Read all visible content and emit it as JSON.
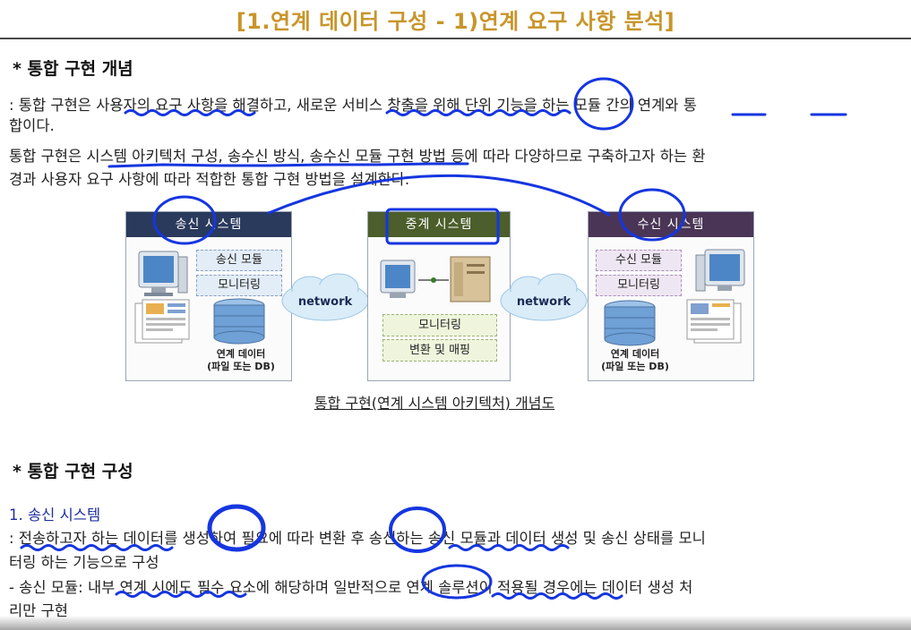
{
  "title": "[1.연계 데이터 구성 - 1)연계 요구 사항 분석]",
  "section1": {
    "heading": "* 통합 구현 개념",
    "para1_line1": ": 통합 구현은 사용자의 요구 사항을 해결하고, 새로운 서비스 창출을 위해 단위 기능을 하는 모듈 간의 연계와 통",
    "para1_line2": "합이다.",
    "para2_line1": "통합 구현은 시스템 아키텍처 구성, 송수신 방식, 송수신 모듈 구현 방법 등에 따라 다양하므로 구축하고자 하는 환",
    "para2_line2": "경과 사용자 요구 사항에 따라 적합한 통합 구현 방법을 설계한다."
  },
  "diagram": {
    "sender": {
      "header": "송신 시스템",
      "module": "송신 모듈",
      "monitor": "모니터링",
      "db_line1": "연계 데이터",
      "db_line2": "(파일 또는 DB)"
    },
    "relay": {
      "header": "중계 시스템",
      "monitor": "모니터링",
      "mapping": "변환 및 매핑"
    },
    "receiver": {
      "header": "수신 시스템",
      "module": "수신 모듈",
      "monitor": "모니터링",
      "db_line1": "연계 데이터",
      "db_line2": "(파일 또는 DB)"
    },
    "network_left": "network",
    "network_right": "network",
    "caption": "통합 구현(연계 시스템 아키텍처) 개념도"
  },
  "section2": {
    "heading": "* 통합 구현 구성",
    "subheading": "1. 송신 시스템",
    "line1": ": 전송하고자 하는 데이터를 생성하여 필요에 따라 변환 후 송신하는 송신 모듈과 데이터 생성 및 송신 상태를 모니",
    "line2": "터링 하는 기능으로 구성",
    "line3": "- 송신 모듈: 내부 연계 시에도 필수 요소에 해당하며 일반적으로 연계 솔루션이 적용될 경우에는 데이터 생성 처",
    "line4": "리만 구현"
  },
  "colors": {
    "title": "#c8952a",
    "annotation_ink": "#1536e0",
    "subheading": "#1f2fa0"
  }
}
